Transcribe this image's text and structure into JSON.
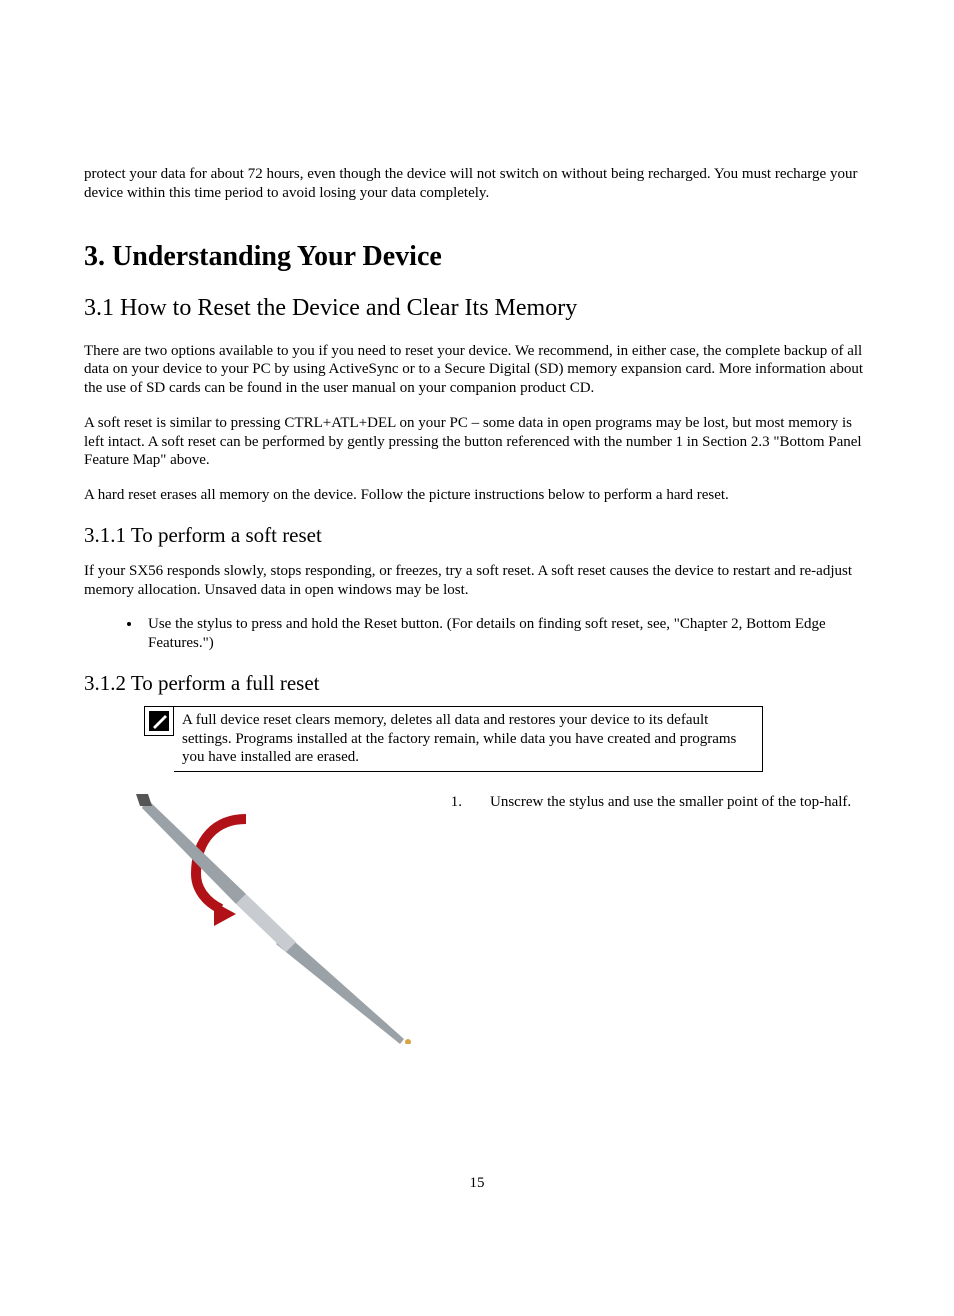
{
  "intro_paragraph": "protect your data for about 72 hours, even though the device will not switch on without being recharged.  You must recharge your device within this time period to avoid losing your data completely.",
  "h1": "3.  Understanding Your Device",
  "h2": "3.1 How to Reset the Device and Clear Its Memory",
  "p1": "There are two options available to you if you need to reset your device.  We recommend, in either case, the complete backup of all data on your device to your PC by using ActiveSync or to a Secure Digital (SD) memory expansion card.  More information about the use of SD cards can be found in the user manual on your companion product CD.",
  "p2": "A soft reset is similar to pressing CTRL+ATL+DEL on your PC – some data in open programs may be lost, but most memory is left intact.  A soft reset can be performed by gently pressing the button referenced with the number 1 in Section 2.3 \"Bottom Panel Feature Map\" above.",
  "p3": "A hard reset erases all memory on the device.  Follow the picture instructions below to perform a hard reset.",
  "h3a": "3.1.1 To perform a soft reset",
  "p4": "If your SX56 responds slowly, stops responding, or freezes, try a soft reset.  A soft reset causes the device to restart and re-adjust memory allocation. Unsaved data in open windows may be lost.",
  "bullet1": "Use the stylus to press and hold the Reset button. (For details on finding soft reset, see, \"Chapter 2, Bottom Edge Features.\")",
  "h3b": "3.1.2 To perform a full reset",
  "note_text": "A full device reset clears memory, deletes all data and restores your device to its default settings.  Programs installed at the factory remain, while data you have created and programs you have installed are erased.",
  "step_num": "1.",
  "step_text": "Unscrew the stylus and use the smaller point of the top‑half.",
  "page_number": "15"
}
